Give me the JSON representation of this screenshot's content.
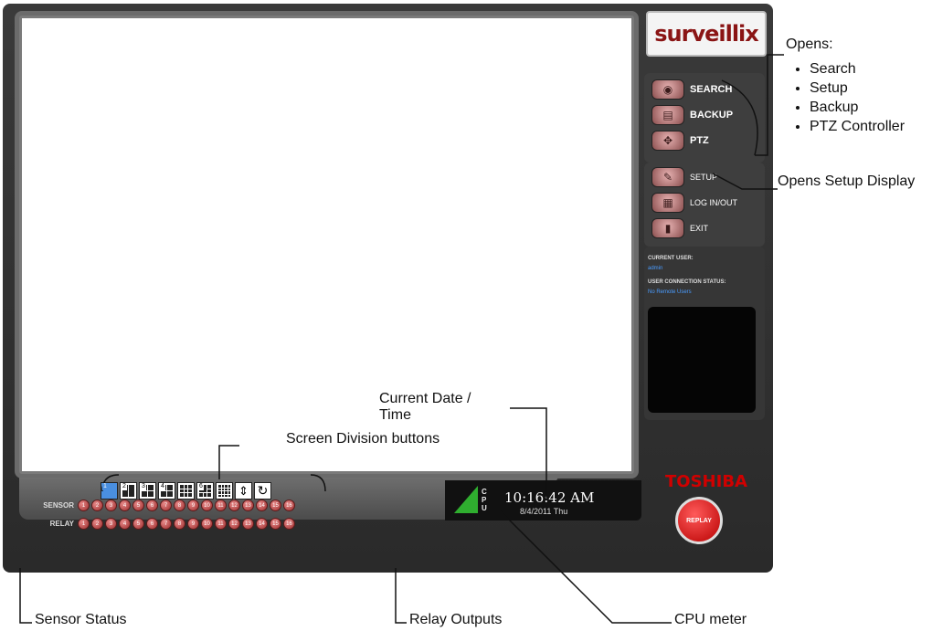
{
  "app": {
    "logo": "surveillix",
    "menu_primary": [
      {
        "label": "SEARCH",
        "icon": "search-icon"
      },
      {
        "label": "BACKUP",
        "icon": "backup-icon"
      },
      {
        "label": "PTZ",
        "icon": "ptz-icon"
      }
    ],
    "menu_secondary": [
      {
        "label": "SETUP",
        "icon": "setup-icon"
      },
      {
        "label": "LOG IN/OUT",
        "icon": "login-icon"
      },
      {
        "label": "EXIT",
        "icon": "exit-icon"
      }
    ],
    "user_panel": {
      "current_user_label": "CURRENT USER:",
      "current_user": "admin",
      "connection_label": "USER CONNECTION STATUS:",
      "connection_status": "No Remote Users"
    },
    "brand": "TOSHIBA",
    "replay_label": "REPLAY",
    "division_buttons": [
      "1",
      "2",
      "3",
      "4",
      "9",
      "6",
      "16",
      "fit",
      "cycle"
    ],
    "cpu_label": "CPU",
    "clock": {
      "time": "10:16:42 AM",
      "date": "8/4/2011 Thu"
    },
    "sensor_label": "SENSOR",
    "relay_label": "RELAY",
    "channels": [
      "1",
      "2",
      "3",
      "4",
      "5",
      "6",
      "7",
      "8",
      "9",
      "10",
      "11",
      "12",
      "13",
      "14",
      "15",
      "16"
    ]
  },
  "callouts": {
    "opens_title": "Opens:",
    "opens_items": [
      "Search",
      "Setup",
      "Backup",
      "PTZ Controller"
    ],
    "setup_display": "Opens Setup Display",
    "date_time": "Current Date / Time",
    "screen_division": "Screen Division buttons",
    "sensor_status": "Sensor Status",
    "relay_outputs": "Relay Outputs",
    "cpu_meter": "CPU meter"
  },
  "colors": {
    "brand_red": "#d00000",
    "active_division": "#4a8fe0",
    "cpu_green": "#2fae2f"
  }
}
